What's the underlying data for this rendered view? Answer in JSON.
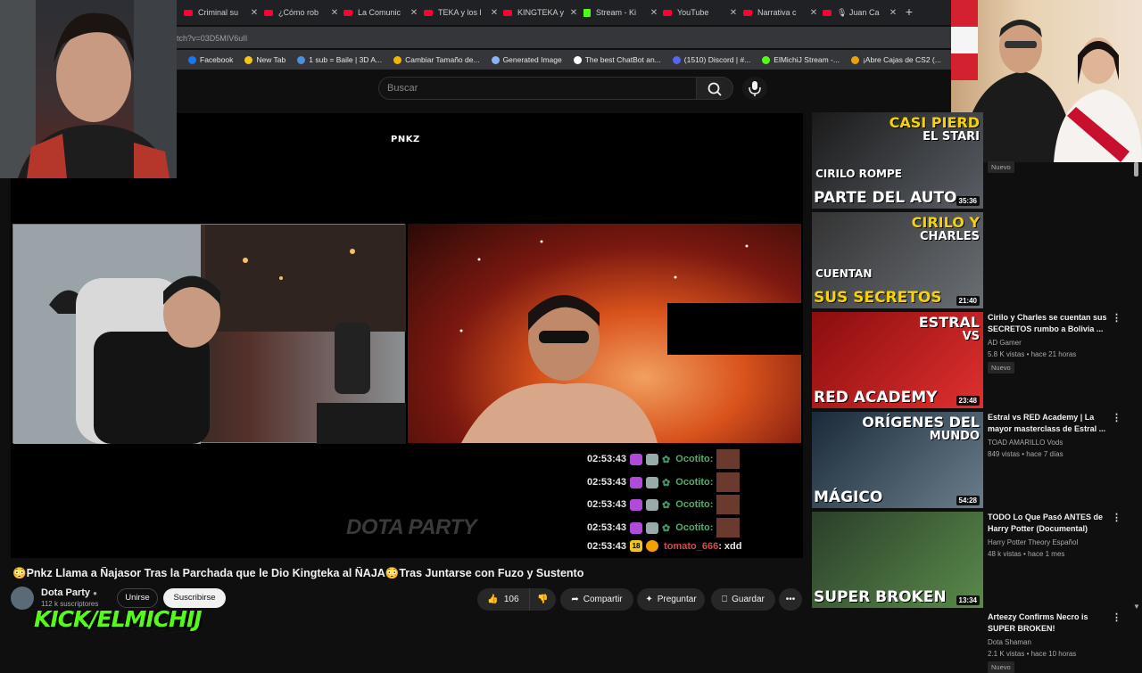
{
  "browser": {
    "tabs": [
      {
        "label": "Criminal su",
        "icon": "youtube-icon"
      },
      {
        "label": "¿Cómo rob",
        "icon": "youtube-icon"
      },
      {
        "label": "La Comunic",
        "icon": "youtube-icon"
      },
      {
        "label": "TEKA y los l",
        "icon": "youtube-icon"
      },
      {
        "label": "KINGTEKA y",
        "icon": "youtube-icon"
      },
      {
        "label": "Stream - Ki",
        "icon": "kick-icon"
      },
      {
        "label": "YouTube",
        "icon": "youtube-icon"
      },
      {
        "label": "Narrativa c",
        "icon": "youtube-icon"
      },
      {
        "label": "🎙 Juan Ca",
        "icon": "youtube-icon"
      }
    ],
    "new_tab": "+",
    "url_fragment": "tch?v=03D5MIV6uII",
    "bookmarks": [
      {
        "label": "Facebook",
        "color": "#1877f2"
      },
      {
        "label": "New Tab",
        "color": "#f5c518"
      },
      {
        "label": "1 sub = Baile | 3D A...",
        "color": "#4a90e2"
      },
      {
        "label": "Cambiar Tamaño de...",
        "color": "#f4b400"
      },
      {
        "label": "Generated Image",
        "color": "#8ab4f8"
      },
      {
        "label": "The best ChatBot an...",
        "color": "#ffffff"
      },
      {
        "label": "(1510) Discord | #...",
        "color": "#5865f2"
      },
      {
        "label": "ElMichiJ Stream -...",
        "color": "#53fc18"
      },
      {
        "label": "¡Abre Cajas de CS2 (...",
        "color": "#e5a50a"
      }
    ]
  },
  "search": {
    "placeholder": "Buscar"
  },
  "player": {
    "overlay_brand": "PNKZ",
    "watermark": "DOTA PARTY",
    "chat": [
      {
        "time": "02:53:43",
        "name": "Ocotito:",
        "msg": ""
      },
      {
        "time": "02:53:43",
        "name": "Ocotito:",
        "msg": ""
      },
      {
        "time": "02:53:43",
        "name": "Ocotito:",
        "msg": ""
      },
      {
        "time": "02:53:43",
        "name": "Ocotito:",
        "msg": ""
      },
      {
        "time": "02:53:43",
        "name": "tomato_666",
        "msg": ": xdd",
        "badge": "18"
      }
    ]
  },
  "video": {
    "title": "😳Pnkz Llama a Ñajasor Tras la Parchada que le Dio Kingteka al ÑAJA😳Tras Juntarse con Fuzo y Sustento",
    "channel": "Dota Party",
    "subscribers": "112 k suscriptores",
    "join_label": "Unirse",
    "subscribe_label": "Suscribirse",
    "likes": "106",
    "share_label": "Compartir",
    "ask_label": "Preguntar",
    "save_label": "Guardar"
  },
  "overlay_text": "KICK/ELMICHIJ",
  "recommendations": [
    {
      "thumb_text_top": "CASI PIERD",
      "thumb_text_sub": "EL STARI",
      "thumb_text_bottom": "PARTE DEL AUTO",
      "thumb_text_mid": "CIRILO ROMPE",
      "duration": "35:36",
      "title": "",
      "channel": "",
      "meta": "",
      "badge": "Nuevo"
    },
    {
      "thumb_text_top": "CIRILO Y",
      "thumb_text_sub": "CHARLES",
      "thumb_text_bottom": "SUS SECRETOS",
      "thumb_text_mid": "CUENTAN",
      "duration": "21:40",
      "title": "Cirilo y Charles se cuentan sus SECRETOS rumbo a Bolivia ...",
      "channel": "AD Gamer",
      "meta": "5.8 K vistas • hace 21 horas",
      "badge": "Nuevo"
    },
    {
      "thumb_text_top": "ESTRAL",
      "thumb_text_sub": "VS",
      "thumb_text_bottom": "RED ACADEMY",
      "thumb_text_mid": "",
      "duration": "23:48",
      "title": "Estral vs RED Academy | La mayor masterclass de Estral ...",
      "channel": "TOAD AMARILLO Vods",
      "meta": "849 vistas • hace 7 días",
      "badge": ""
    },
    {
      "thumb_text_top": "ORÍGENES DEL",
      "thumb_text_sub": "MUNDO",
      "thumb_text_bottom": "MÁGICO",
      "thumb_text_mid": "",
      "duration": "54:28",
      "title": "TODO Lo Que Pasó ANTES de Harry Potter (Documental)",
      "channel": "Harry Potter Theory Español",
      "meta": "48 k vistas • hace 1 mes",
      "badge": ""
    },
    {
      "thumb_text_top": "",
      "thumb_text_sub": "",
      "thumb_text_bottom": "SUPER BROKEN",
      "thumb_text_mid": "",
      "duration": "13:34",
      "title": "Arteezy Confirms Necro is SUPER BROKEN!",
      "channel": "Dota Shaman",
      "meta": "2.1 K vistas • hace 10 horas",
      "badge": "Nuevo"
    }
  ],
  "colors": {
    "youtube_red": "#ff0033",
    "kick_green": "#53fc18",
    "bg": "#0f0f0f"
  }
}
